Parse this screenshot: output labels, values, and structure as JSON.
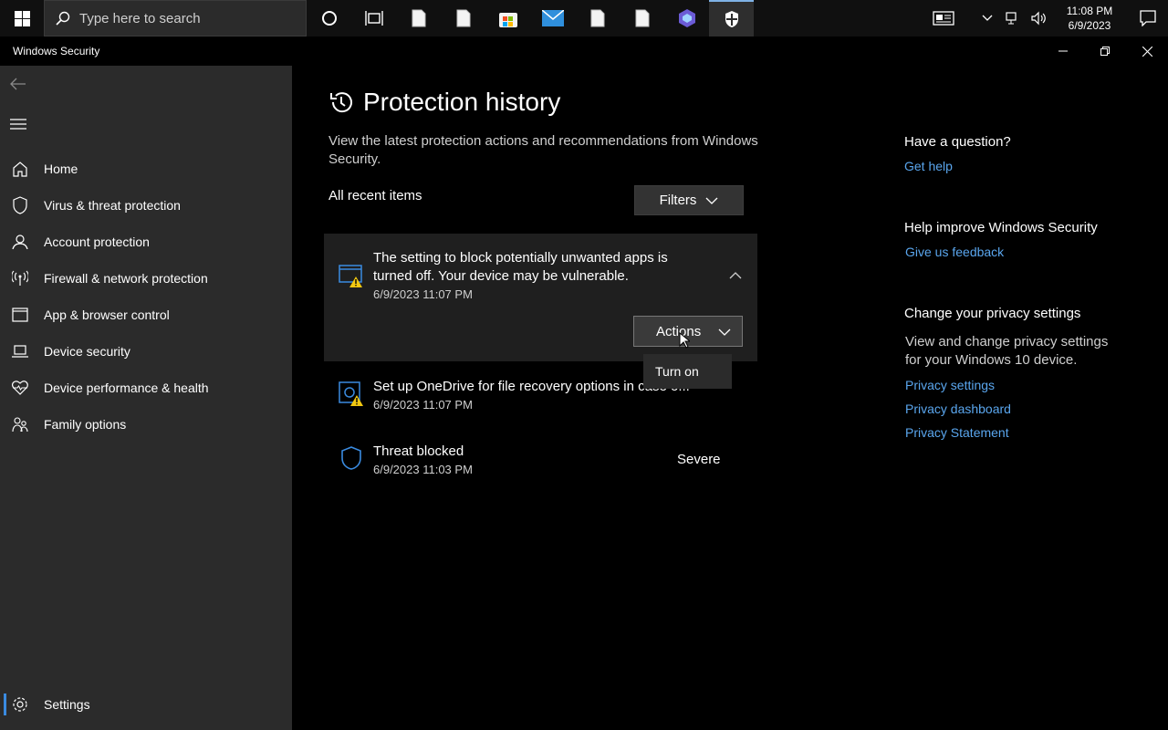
{
  "taskbar": {
    "search_placeholder": "Type here to search",
    "clock_time": "11:08 PM",
    "clock_date": "6/9/2023"
  },
  "window": {
    "title": "Windows Security"
  },
  "sidebar": {
    "items": [
      {
        "label": "Home",
        "icon": "home-icon"
      },
      {
        "label": "Virus & threat protection",
        "icon": "shield-icon"
      },
      {
        "label": "Account protection",
        "icon": "person-icon"
      },
      {
        "label": "Firewall & network protection",
        "icon": "antenna-icon"
      },
      {
        "label": "App & browser control",
        "icon": "browser-window-icon"
      },
      {
        "label": "Device security",
        "icon": "laptop-icon"
      },
      {
        "label": "Device performance & health",
        "icon": "heart-pulse-icon"
      },
      {
        "label": "Family options",
        "icon": "family-icon"
      }
    ],
    "settings_label": "Settings"
  },
  "main": {
    "title": "Protection history",
    "description": "View the latest protection actions and recommendations from Windows Security.",
    "recent_label": "All recent items",
    "filters_label": "Filters",
    "items": [
      {
        "title": "The setting to block potentially unwanted apps is turned off. Your device may be vulnerable.",
        "time": "6/9/2023 11:07 PM",
        "actions_label": "Actions",
        "dropdown_option": "Turn on"
      },
      {
        "title": "Set up OneDrive for file recovery options in case o...",
        "time": "6/9/2023 11:07 PM"
      },
      {
        "title": "Threat blocked",
        "time": "6/9/2023 11:03 PM",
        "severity": "Severe"
      }
    ]
  },
  "right": {
    "question_head": "Have a question?",
    "get_help": "Get help",
    "improve_head": "Help improve Windows Security",
    "feedback": "Give us feedback",
    "privacy_head": "Change your privacy settings",
    "privacy_text": "View and change privacy settings for your Windows 10 device.",
    "privacy_settings": "Privacy settings",
    "privacy_dashboard": "Privacy dashboard",
    "privacy_statement": "Privacy Statement"
  },
  "colors": {
    "link": "#5aa6ee",
    "sidebar_bg": "#2b2b2b",
    "accent": "#3a8be0",
    "warning": "#f2c811"
  }
}
